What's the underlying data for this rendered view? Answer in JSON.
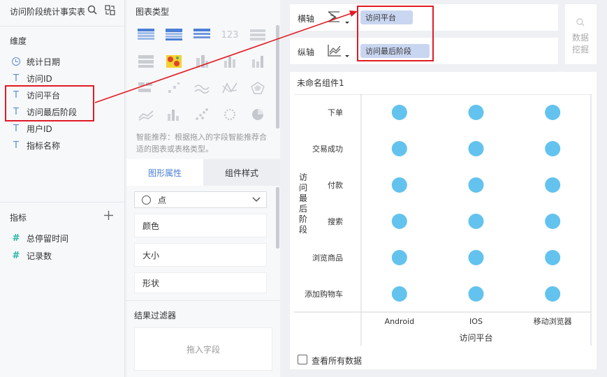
{
  "left": {
    "title": "访问阶段统计事实表",
    "dim_label": "维度",
    "dimensions": [
      {
        "label": "统计日期",
        "icon": "clock-icon"
      },
      {
        "label": "访问ID",
        "icon": "text-icon"
      },
      {
        "label": "访问平台",
        "icon": "text-icon"
      },
      {
        "label": "访问最后阶段",
        "icon": "text-icon"
      },
      {
        "label": "用户ID",
        "icon": "text-icon"
      },
      {
        "label": "指标名称",
        "icon": "text-icon"
      }
    ],
    "metric_label": "指标",
    "metrics": [
      {
        "label": "总停留时间",
        "icon": "hash-icon"
      },
      {
        "label": "记录数",
        "icon": "hash-icon"
      }
    ],
    "type_glyph": "T",
    "hash_glyph": "#"
  },
  "mid": {
    "chart_type_label": "图表类型",
    "hint": "智能推荐：根据拖入的字段智能推荐合适的图表或表格类型。",
    "tabs": [
      "图形属性",
      "组件样式"
    ],
    "mark_type": "点",
    "props": [
      "颜色",
      "大小",
      "形状"
    ],
    "filter_label": "结果过滤器",
    "filter_placeholder": "拖入字段",
    "num_icon_text": "123"
  },
  "shelves": {
    "x_label": "横轴",
    "y_label": "纵轴",
    "x_field": "访问平台",
    "y_field": "访问最后阶段",
    "mining_label_1": "数据",
    "mining_label_2": "挖掘"
  },
  "chart": {
    "name": "未命名组件1",
    "show_all_label": "查看所有数据"
  },
  "chart_data": {
    "type": "scatter",
    "x_categories": [
      "Android",
      "IOS",
      "移动浏览器"
    ],
    "y_categories": [
      "下单",
      "交易成功",
      "付款",
      "搜索",
      "浏览商品",
      "添加购物车"
    ],
    "xlabel": "访问平台",
    "ylabel": "访问最后阶段",
    "point_color": "#63c3ee"
  },
  "colors": {
    "accent": "#4a7fd6",
    "highlight": "#e01b24",
    "pill": "#c9d6f1"
  }
}
